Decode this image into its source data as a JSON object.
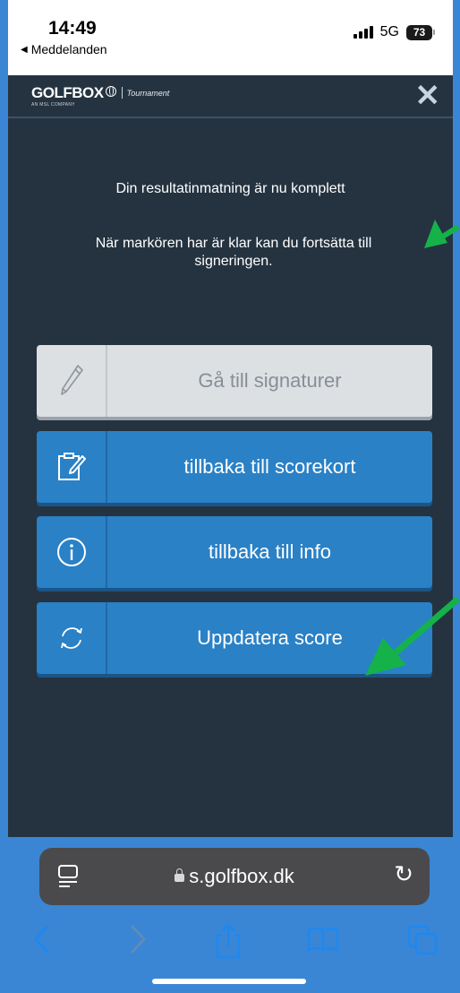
{
  "status_bar": {
    "time": "14:49",
    "back_label": "Meddelanden",
    "network": "5G",
    "battery": "73"
  },
  "header": {
    "logo": "GOLFBOX",
    "logo_sub": "AN MSL COMPANY",
    "logo_tag": "Tournament"
  },
  "content": {
    "message_complete": "Din resultatinmatning är nu komplett",
    "message_marker": "När markören har är klar kan du fortsätta till signeringen."
  },
  "buttons": [
    {
      "label": "Gå till signaturer",
      "icon": "pen-icon",
      "state": "disabled"
    },
    {
      "label": "tillbaka till scorekort",
      "icon": "clipboard-edit-icon",
      "state": "enabled"
    },
    {
      "label": "tillbaka till info",
      "icon": "info-icon",
      "state": "enabled"
    },
    {
      "label": "Uppdatera score",
      "icon": "refresh-icon",
      "state": "enabled"
    }
  ],
  "browser": {
    "url": "s.golfbox.dk"
  },
  "colors": {
    "app_bg": "#253340",
    "button_blue": "#2a81c6",
    "button_gray": "#dde0e3",
    "annotation_arrow": "#15b24a",
    "frame_bg": "#3a86d4"
  }
}
